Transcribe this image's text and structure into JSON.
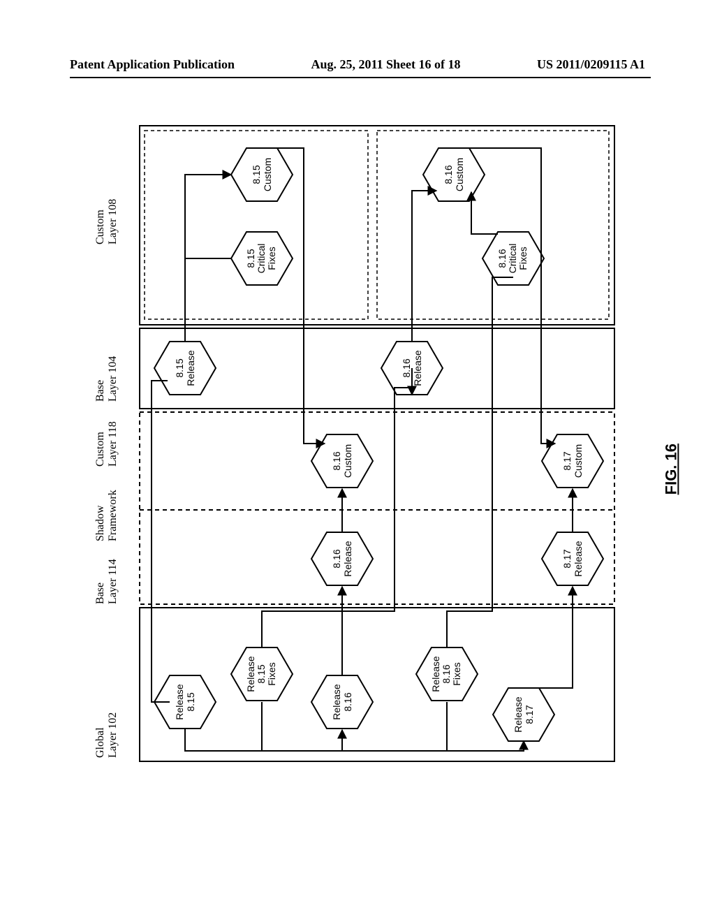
{
  "header": {
    "left": "Patent Application Publication",
    "center": "Aug. 25, 2011  Sheet 16 of 18",
    "right": "US 2011/0209115 A1"
  },
  "figure_caption": "FIG. 16",
  "layers": {
    "global": {
      "line1": "Global",
      "line2": "Layer 102"
    },
    "base_shadow": {
      "line1": "Base",
      "line2": "Layer 114"
    },
    "shadow_fw": {
      "line1": "Shadow",
      "line2": "Framework"
    },
    "custom_shadow": {
      "line1": "Custom",
      "line2": "Layer 118"
    },
    "base": {
      "line1": "Base",
      "line2": "Layer 104"
    },
    "custom": {
      "line1": "Custom",
      "line2": "Layer 108"
    }
  },
  "nodes": {
    "g_815": {
      "l1": "Release",
      "l2": "8.15"
    },
    "g_815_fix": {
      "l1": "Release",
      "l2": "8.15",
      "l3": "Fixes"
    },
    "g_816": {
      "l1": "Release",
      "l2": "8.16"
    },
    "g_816_fix": {
      "l1": "Release",
      "l2": "8.16",
      "l3": "Fixes"
    },
    "g_817": {
      "l1": "Release",
      "l2": "8.17"
    },
    "sb_816_rel": {
      "l1": "8.16",
      "l2": "Release"
    },
    "sc_816_cus": {
      "l1": "8.16",
      "l2": "Custom"
    },
    "sb_817_rel": {
      "l1": "8.17",
      "l2": "Release"
    },
    "sc_817_cus": {
      "l1": "8.17",
      "l2": "Custom"
    },
    "b_815_rel": {
      "l1": "8.15",
      "l2": "Release"
    },
    "b_816_rel": {
      "l1": "8.16",
      "l2": "Release"
    },
    "c_815_cf": {
      "l1": "8.15",
      "l2": "Critical",
      "l3": "Fixes"
    },
    "c_815_cus": {
      "l1": "8.15",
      "l2": "Custom"
    },
    "c_816_cf": {
      "l1": "8.16",
      "l2": "Critical",
      "l3": "Fixes"
    },
    "c_816_cus": {
      "l1": "8.16",
      "l2": "Custom"
    }
  }
}
